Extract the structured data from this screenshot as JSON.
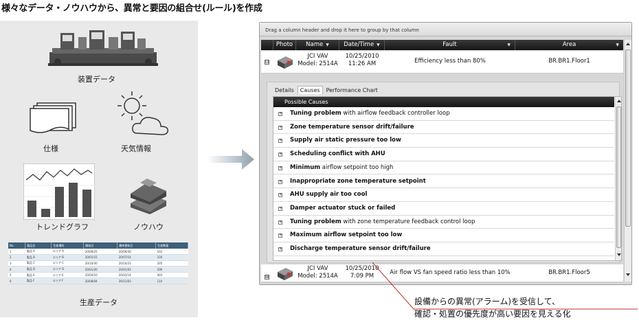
{
  "headline": "様々なデータ・ノウハウから、異常と要因の組合せ(ルール)を作成",
  "left": {
    "equipment_label": "装置データ",
    "spec_label": "仕様",
    "weather_label": "天気情報",
    "trend_label": "トレンドグラフ",
    "knowhow_label": "ノウハウ",
    "production_label": "生産データ",
    "table_headers": [
      "No.",
      "製品名",
      "生産場所",
      "開始日",
      "最終更新日",
      "生産数量"
    ],
    "table_rows": [
      [
        "1",
        "製品 A",
        "エリア A",
        "20/09/25",
        "20/09/26",
        "102"
      ],
      [
        "2",
        "製品 B",
        "エリア B",
        "20/01/15",
        "20/07/14",
        "100"
      ],
      [
        "3",
        "製品 C",
        "エリア C",
        "20/10/30",
        "20/10/23",
        "205"
      ],
      [
        "4",
        "製品 D",
        "エリア D",
        "20/01/20",
        "20/01/03",
        "206"
      ],
      [
        "5",
        "製品 E",
        "エリア E",
        "20/04/10",
        "20/02/14",
        "403"
      ],
      [
        "6",
        "製品 F",
        "エリア F",
        "20/08/04",
        "20/11/03",
        "110"
      ]
    ]
  },
  "window": {
    "group_bar": "Drag a column header and drop it here to group by that column",
    "columns": {
      "photo": "Photo",
      "name": "Name",
      "datetime": "Date/Time",
      "fault": "Fault",
      "area": "Area"
    },
    "row1": {
      "expander": "⊟",
      "name_line1": "JCI VAV",
      "name_line2": "Model: 2514A",
      "date": "10/25/2010",
      "time": "11:26 AM",
      "fault": "Efficiency less than 80%",
      "area": "BR.BR1.Floor1"
    },
    "tabs": {
      "details": "Details",
      "causes": "Causes",
      "performance": "Performance Chart"
    },
    "causes_header": "Possible Causes",
    "causes": [
      {
        "bold": "Tuning problem",
        "rest": " with airflow feedback controller loop"
      },
      {
        "bold": "Zone temperature sensor drift/failure",
        "rest": ""
      },
      {
        "bold": "Supply air static pressure too low",
        "rest": ""
      },
      {
        "bold": "Scheduling conflict with AHU",
        "rest": ""
      },
      {
        "bold": "Minimum",
        "rest": " airflow setpoint too high"
      },
      {
        "bold": "Inappropriate zone temperature setpoint",
        "rest": ""
      },
      {
        "bold": "AHU supply air too cool",
        "rest": ""
      },
      {
        "bold": "Damper actuator stuck or failed",
        "rest": ""
      },
      {
        "bold": "Tuning problem",
        "rest": " with zone temperature feedback control loop"
      },
      {
        "bold": "Maximum airflow setpoint too low",
        "rest": ""
      },
      {
        "bold": "Discharge temperature sensor drift/failure",
        "rest": ""
      }
    ],
    "row2": {
      "expander": "⊞",
      "name_line1": "JCI VAV",
      "name_line2": "Model: 2514A",
      "date": "10/25/2010",
      "time": "7:09 PM",
      "fault": "Air flow VS fan speed ratio less than 10%",
      "area": "BR.BR1.Floor5"
    }
  },
  "callout": {
    "line1": "設備からの異常(アラーム)を受信して、",
    "line2": "確認・処置の優先度が高い要因を見える化"
  },
  "colors": {
    "panel_bg": "#e9e9e9",
    "header_dark": "#1c1c1c",
    "table_header": "#3d5f78",
    "pointer_line": "#c03030"
  }
}
